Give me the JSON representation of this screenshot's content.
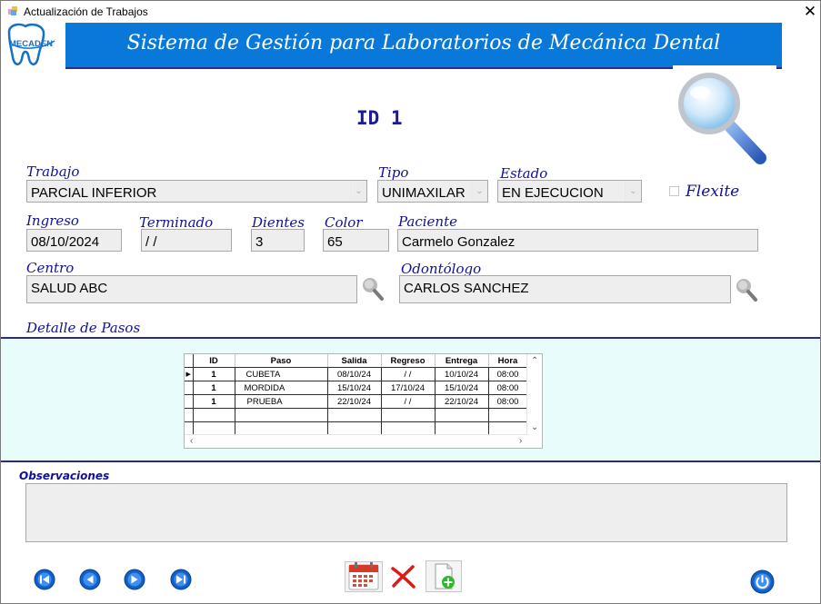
{
  "window": {
    "title": "Actualización de Trabajos",
    "close_glyph": "✕"
  },
  "logo": {
    "text": "MECADEN"
  },
  "header": {
    "banner": "Sistema de Gestión para Laboratorios de Mecánica Dental"
  },
  "record": {
    "id_label": "ID  1"
  },
  "form": {
    "trabajo": {
      "label": "Trabajo",
      "value": "PARCIAL INFERIOR"
    },
    "tipo": {
      "label": "Tipo",
      "value": "UNIMAXILAR"
    },
    "estado": {
      "label": "Estado",
      "value": "EN EJECUCION"
    },
    "flexite": {
      "label": "Flexite",
      "checked": false
    },
    "ingreso": {
      "label": "Ingreso",
      "value": "08/10/2024"
    },
    "terminado": {
      "label": "Terminado",
      "value": " /  /"
    },
    "dientes": {
      "label": "Dientes",
      "value": "3"
    },
    "color": {
      "label": "Color",
      "value": "65"
    },
    "paciente": {
      "label": "Paciente",
      "value": "Carmelo Gonzalez"
    },
    "centro": {
      "label": "Centro",
      "value": "SALUD ABC"
    },
    "odontologo": {
      "label": "Odontólogo",
      "value": "CARLOS SANCHEZ"
    }
  },
  "detalle": {
    "label": "Detalle de Pasos",
    "columns": [
      "ID",
      "Paso",
      "Salida",
      "Regreso",
      "Entrega",
      "Hora"
    ],
    "rows": [
      [
        "1",
        "CUBETA",
        "08/10/24",
        " / /",
        "10/10/24",
        "08:00"
      ],
      [
        "1",
        "MORDIDA",
        "15/10/24",
        "17/10/24",
        "15/10/24",
        "08:00"
      ],
      [
        "1",
        "PRUEBA",
        "22/10/24",
        " / /",
        "22/10/24",
        "08:00"
      ],
      [
        "",
        "",
        "",
        "",
        "",
        ""
      ],
      [
        "",
        "",
        "",
        "",
        "",
        ""
      ]
    ]
  },
  "observaciones": {
    "label": "Observaciones",
    "value": ""
  },
  "colors": {
    "banner": "#0a78d8",
    "label": "#111199",
    "band": "#e8fcfc",
    "nav": "#1060c8"
  }
}
